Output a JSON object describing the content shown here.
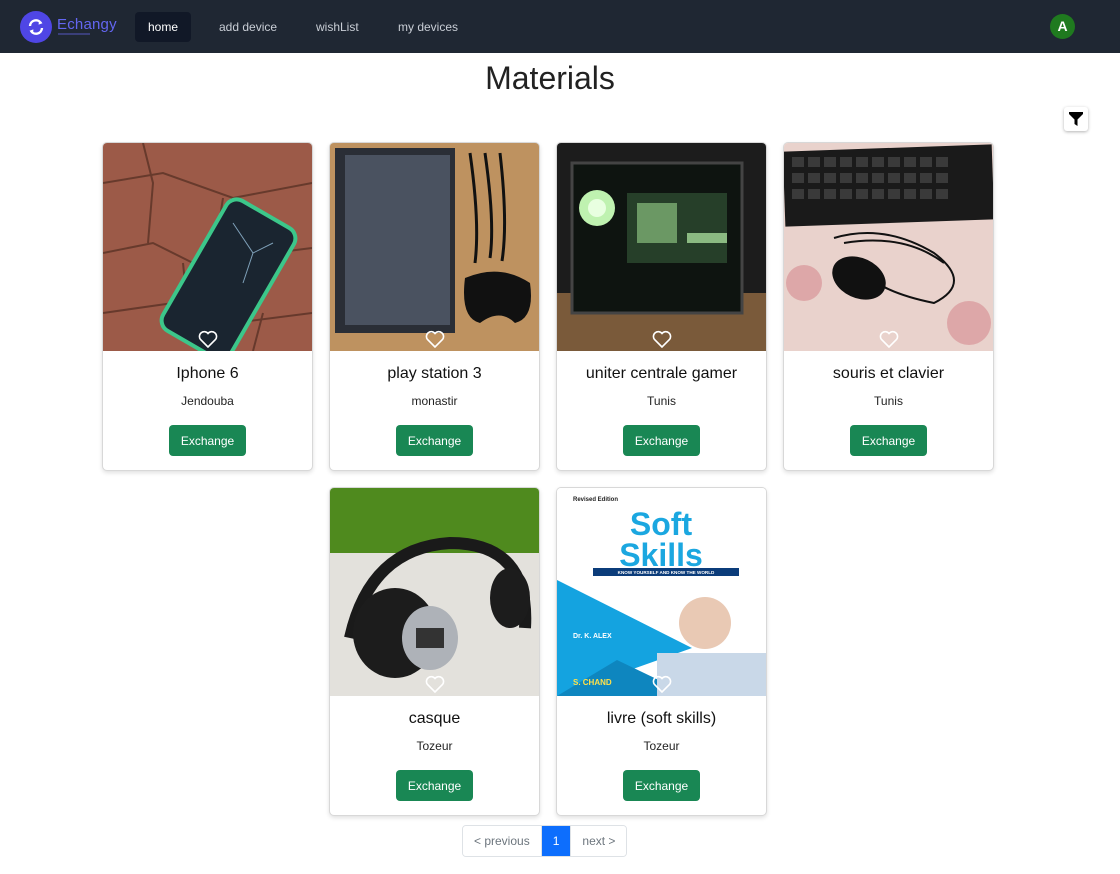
{
  "navbar": {
    "brand": "Echangy",
    "links": [
      {
        "label": "home",
        "active": true
      },
      {
        "label": "add device",
        "active": false
      },
      {
        "label": "wishList",
        "active": false
      },
      {
        "label": "my devices",
        "active": false
      }
    ],
    "avatar_initial": "A"
  },
  "page": {
    "title": "Materials"
  },
  "cards": [
    {
      "title": "Iphone 6",
      "city": "Jendouba",
      "button": "Exchange",
      "image": "phone-photo"
    },
    {
      "title": "play station 3",
      "city": "monastir",
      "button": "Exchange",
      "image": "console-photo"
    },
    {
      "title": "uniter centrale gamer",
      "city": "Tunis",
      "button": "Exchange",
      "image": "pc-tower-photo"
    },
    {
      "title": "souris et clavier",
      "city": "Tunis",
      "button": "Exchange",
      "image": "mouse-keyboard-photo"
    },
    {
      "title": "casque",
      "city": "Tozeur",
      "button": "Exchange",
      "image": "headphones-photo"
    },
    {
      "title": "livre (soft skills)",
      "city": "Tozeur",
      "button": "Exchange",
      "image": "book-cover"
    }
  ],
  "book_cover": {
    "edition": "Revised Edition",
    "title_line1": "Soft",
    "title_line2": "Skills",
    "tagline": "KNOW YOURSELF AND KNOW THE WORLD",
    "author": "Dr. K. ALEX",
    "publisher": "S. CHAND"
  },
  "pagination": {
    "previous": "< previous",
    "current": "1",
    "next": "next >"
  },
  "colors": {
    "navbar": "#1f2733",
    "brand": "#6366f1",
    "exchange_button": "#198754",
    "pagination_active": "#0d6efd",
    "avatar": "#1f7a1f"
  }
}
